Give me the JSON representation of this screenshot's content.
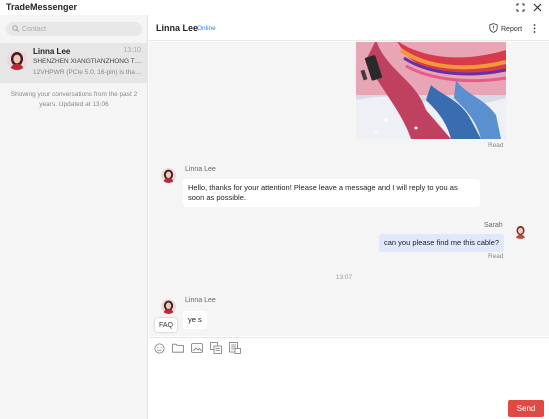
{
  "app": {
    "title": "TradeMessenger"
  },
  "window_controls": [
    {
      "icon": "maximize-icon"
    },
    {
      "icon": "close-icon"
    }
  ],
  "search": {
    "placeholder": "Contact",
    "value": ""
  },
  "conversations": [
    {
      "name": "Linna Lee",
      "time": "13:10",
      "company": "SHENZHEN XIANGTIANZHONG TE...",
      "preview": "12VHPWR (PCIe 5.0, 16-pin) is that ..."
    }
  ],
  "history_note": "Showing your conversations from the past 2 years. Updated at 13:06",
  "chat": {
    "contact_name": "Linna Lee",
    "status": "Online",
    "status_color": "#1e88e5",
    "report_label": "Report"
  },
  "messages": {
    "image_read": "Read",
    "msg1": {
      "sender": "Linna Lee",
      "text": "Hello, thanks for your attention! Please leave a message and I will reply to you as soon as possible."
    },
    "msg2": {
      "sender": "Sarah",
      "text": "can you please find me this cable?",
      "read": "Read"
    },
    "time_separator": "13:07",
    "msg3": {
      "sender": "Linna Lee",
      "text": "ye s"
    }
  },
  "faq_label": "FAQ",
  "toolbar": {
    "tools": [
      "emoji-icon",
      "folder-icon",
      "image-icon",
      "product-icon",
      "order-icon"
    ]
  },
  "composer": {
    "value": ""
  },
  "send_label": "Send",
  "colors": {
    "accent": "#e04a43",
    "outgoing_bubble": "#dfe9fb",
    "chat_background": "#f5f5f5"
  }
}
